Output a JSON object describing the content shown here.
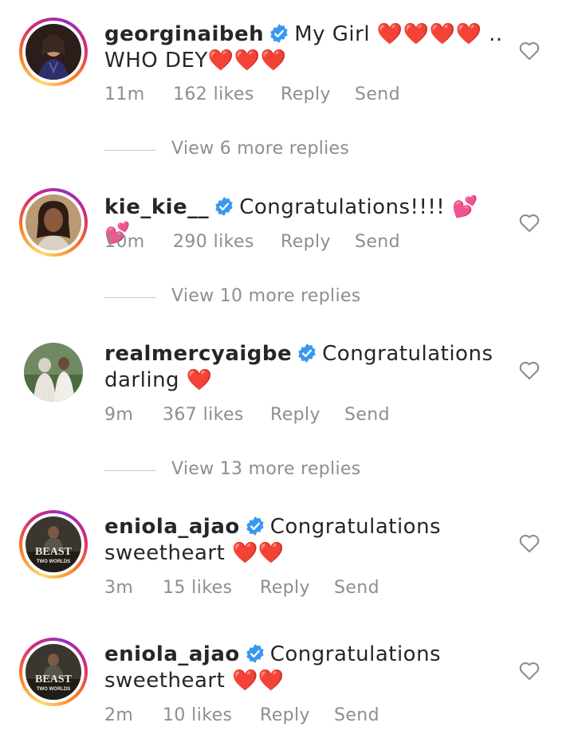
{
  "comments": [
    {
      "username": "georginaibeh",
      "text": "My Girl ❤️❤️❤️❤️ ..\nWHO DEY❤️❤️❤️",
      "line1": "My Girl ❤️❤️❤️❤️ ..",
      "line2": "WHO DEY❤️❤️❤️",
      "time": "11m",
      "likes": "162 likes",
      "reply": "Reply",
      "send": "Send"
    },
    {
      "username": "kie_kie__",
      "text": "Congratulations!!!! 💕💕",
      "time": "10m",
      "likes": "290 likes",
      "reply": "Reply",
      "send": "Send"
    },
    {
      "username": "realmercyaigbe",
      "line1": "Congratulations",
      "line2": "darling ❤️",
      "time": "9m",
      "likes": "367 likes",
      "reply": "Reply",
      "send": "Send"
    },
    {
      "username": "eniola_ajao",
      "line1": "Congratulations",
      "line2": "sweetheart ❤️❤️",
      "time": "3m",
      "likes": "15 likes",
      "reply": "Reply",
      "send": "Send",
      "avatar_text_1": "BEAST",
      "avatar_text_2": "TWO WORLDS"
    },
    {
      "username": "eniola_ajao",
      "line1": "Congratulations",
      "line2": "sweetheart ❤️❤️",
      "time": "2m",
      "likes": "10 likes",
      "reply": "Reply",
      "send": "Send",
      "avatar_text_1": "BEAST",
      "avatar_text_2": "TWO WORLDS"
    }
  ],
  "view_more": [
    "View 6 more replies",
    "View 10 more replies",
    "View 13 more replies"
  ],
  "colors": {
    "verified": "#3897f0",
    "meta": "#8e8e8e",
    "text": "#262626",
    "heart_outline": "#8e8e8e"
  },
  "icons": {
    "verified": "verified-badge-icon",
    "like": "heart-outline-icon"
  }
}
